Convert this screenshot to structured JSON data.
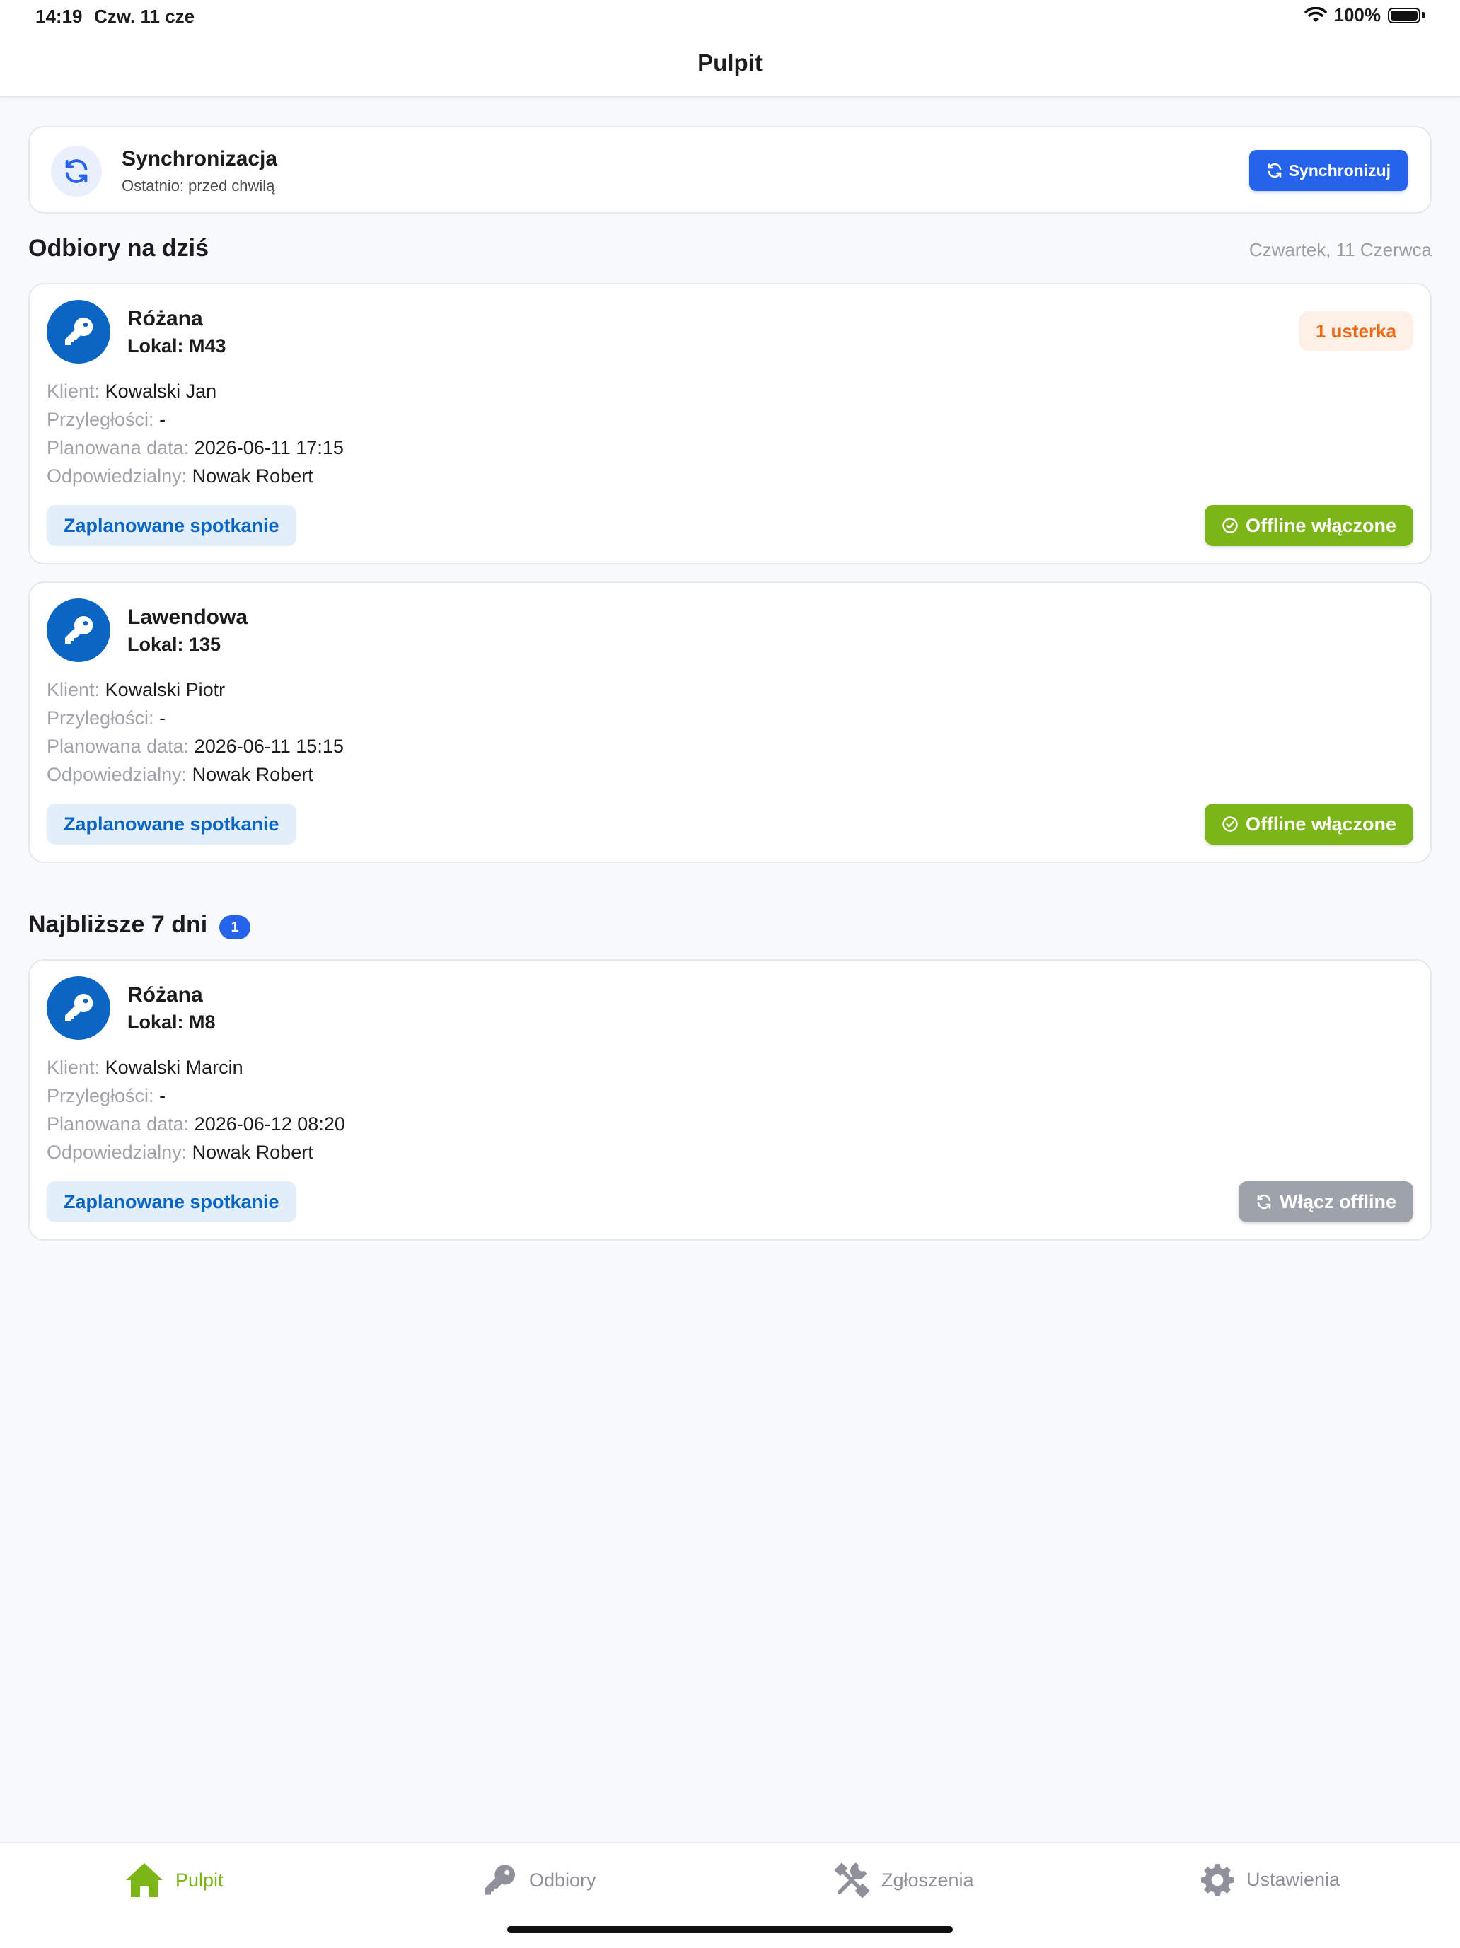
{
  "status_bar": {
    "time": "14:19",
    "date": "Czw. 11 cze",
    "battery": "100%"
  },
  "nav": {
    "title": "Pulpit"
  },
  "sync": {
    "title": "Synchronizacja",
    "subtitle": "Ostatnio: przed chwilą",
    "button_label": "Synchronizuj"
  },
  "today": {
    "title": "Odbiory na dziś",
    "date": "Czwartek, 11 Czerwca",
    "items": [
      {
        "name": "Różana",
        "unit": "Lokal: M43",
        "defects": "1 usterka",
        "client_label": "Klient:",
        "client": "Kowalski Jan",
        "adjacent_label": "Przyległości:",
        "adjacent": "-",
        "date_label": "Planowana data:",
        "date": "2026-06-11 17:15",
        "responsible_label": "Odpowiedzialny:",
        "responsible": "Nowak Robert",
        "status": "Zaplanowane spotkanie",
        "offline": "Offline włączone"
      },
      {
        "name": "Lawendowa",
        "unit": "Lokal: 135",
        "client_label": "Klient:",
        "client": "Kowalski Piotr",
        "adjacent_label": "Przyległości:",
        "adjacent": "-",
        "date_label": "Planowana data:",
        "date": "2026-06-11 15:15",
        "responsible_label": "Odpowiedzialny:",
        "responsible": "Nowak Robert",
        "status": "Zaplanowane spotkanie",
        "offline": "Offline włączone"
      }
    ]
  },
  "next7": {
    "title": "Najbliższe 7 dni",
    "count": "1",
    "items": [
      {
        "name": "Różana",
        "unit": "Lokal: M8",
        "client_label": "Klient:",
        "client": "Kowalski Marcin",
        "adjacent_label": "Przyległości:",
        "adjacent": "-",
        "date_label": "Planowana data:",
        "date": "2026-06-12 08:20",
        "responsible_label": "Odpowiedzialny:",
        "responsible": "Nowak Robert",
        "status": "Zaplanowane spotkanie",
        "offline": "Włącz offline"
      }
    ]
  },
  "tabs": [
    {
      "label": "Pulpit",
      "icon": "home-icon",
      "active": true
    },
    {
      "label": "Odbiory",
      "icon": "key-icon",
      "active": false
    },
    {
      "label": "Zgłoszenia",
      "icon": "tools-icon",
      "active": false
    },
    {
      "label": "Ustawienia",
      "icon": "gear-icon",
      "active": false
    }
  ],
  "colors": {
    "accent_blue": "#2563eb",
    "key_blue": "#0a66c2",
    "active_green": "#7cb518",
    "defect_orange": "#ea6a16",
    "inactive_gray": "#9ea3ab"
  }
}
